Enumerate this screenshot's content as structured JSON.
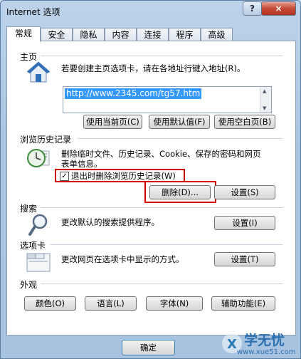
{
  "window": {
    "title": "Internet 选项",
    "help_label": "?",
    "close_label": "×"
  },
  "tabs": [
    {
      "label": "常规",
      "active": true
    },
    {
      "label": "安全"
    },
    {
      "label": "隐私"
    },
    {
      "label": "内容"
    },
    {
      "label": "连接"
    },
    {
      "label": "程序"
    },
    {
      "label": "高级"
    }
  ],
  "home": {
    "heading": "主页",
    "description": "若要创建主页选项卡，请在各地址行键入地址(R)。",
    "url": "http://www.2345.com/tg57.htm",
    "btn_current": "使用当前页(C)",
    "btn_default": "使用默认值(F)",
    "btn_blank": "使用空白页(B)"
  },
  "history": {
    "heading": "浏览历史记录",
    "description_line1": "删除临时文件、历史记录、Cookie、保存的密码和网页",
    "description_line2": "表单信息。",
    "checkbox_label": "退出时删除浏览历史记录(W)",
    "checkbox_mark": "✓",
    "btn_delete": "删除(D)...",
    "btn_settings": "设置(S)"
  },
  "search": {
    "heading": "搜索",
    "description": "更改默认的搜索提供程序。",
    "btn_settings": "设置(I)"
  },
  "tabsection": {
    "heading": "选项卡",
    "description": "更改网页在选项卡中显示的方式。",
    "btn_settings": "设置(T)"
  },
  "appearance": {
    "heading": "外观",
    "btn_colors": "颜色(O)",
    "btn_languages": "语言(L)",
    "btn_fonts": "字体(N)",
    "btn_accessibility": "辅助功能(E)"
  },
  "footer": {
    "btn_ok": "确定"
  },
  "watermark": {
    "text": "学无忧",
    "url": "www.xue51.com"
  },
  "colors": {
    "highlight": "#3399ff",
    "annotation": "#d00000"
  }
}
